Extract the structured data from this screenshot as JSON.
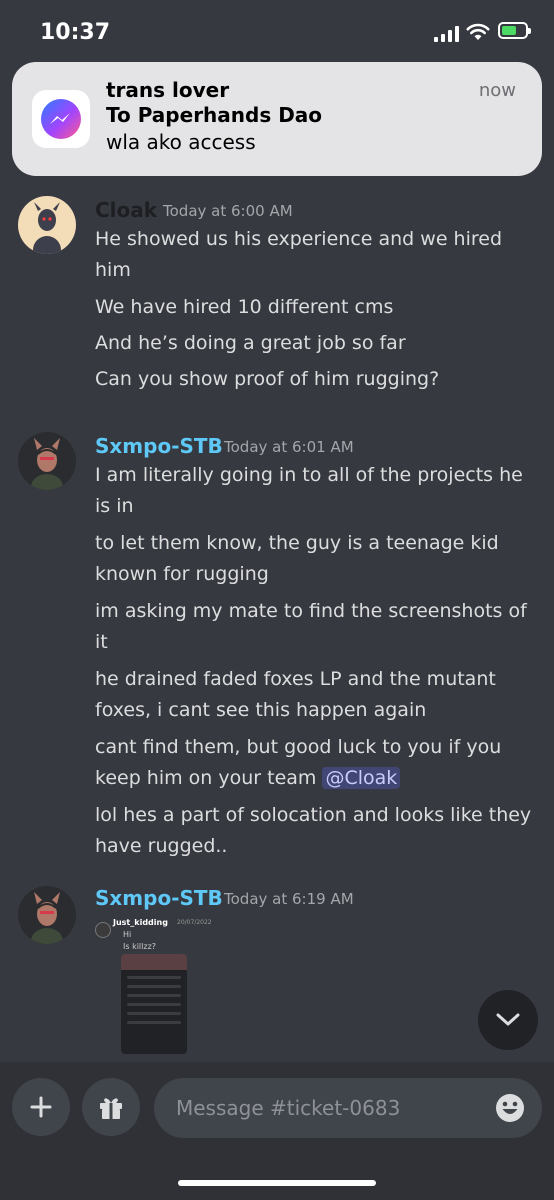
{
  "status_bar": {
    "time": "10:37"
  },
  "notification": {
    "title": "trans lover",
    "subtitle": "To Paperhands Dao",
    "body": "wla ako access",
    "time": "now",
    "app_icon": "messenger-icon"
  },
  "messages": [
    {
      "username": "Cloak",
      "username_color": "#1e1f22",
      "timestamp": "Today at 6:00 AM",
      "lines": [
        "He showed us his experience and we hired him",
        "We have hired 10 different cms",
        "And he’s doing a great job so far",
        "Can you show proof of him rugging?"
      ]
    },
    {
      "username": "Sxmpo-STB",
      "username_color": "#5ec8f7",
      "timestamp": "Today at 6:01 AM",
      "lines": [
        "I am literally going in to all of the projects he is in",
        "to let them know, the guy is a teenage kid known for rugging",
        "im asking my mate to find the screenshots of it",
        "he drained faded foxes LP and the mutant foxes, i cant see this happen again",
        "cant find them, but good luck to you if you keep him on your team",
        "lol hes a part of solocation and looks like they have rugged.."
      ],
      "mention": "@Cloak"
    },
    {
      "username": "Sxmpo-STB",
      "username_color": "#5ec8f7",
      "timestamp": "Today at 6:19 AM",
      "attachment": {
        "user": "Just_kidding",
        "date": "20/07/2022",
        "line1": "Hi",
        "line2": "Is killzz?"
      }
    }
  ],
  "composer": {
    "placeholder": "Message #ticket-0683"
  },
  "icons": {
    "add": "plus-icon",
    "gift": "gift-icon",
    "emoji": "emoji-icon",
    "scroll": "chevron-down-icon"
  }
}
